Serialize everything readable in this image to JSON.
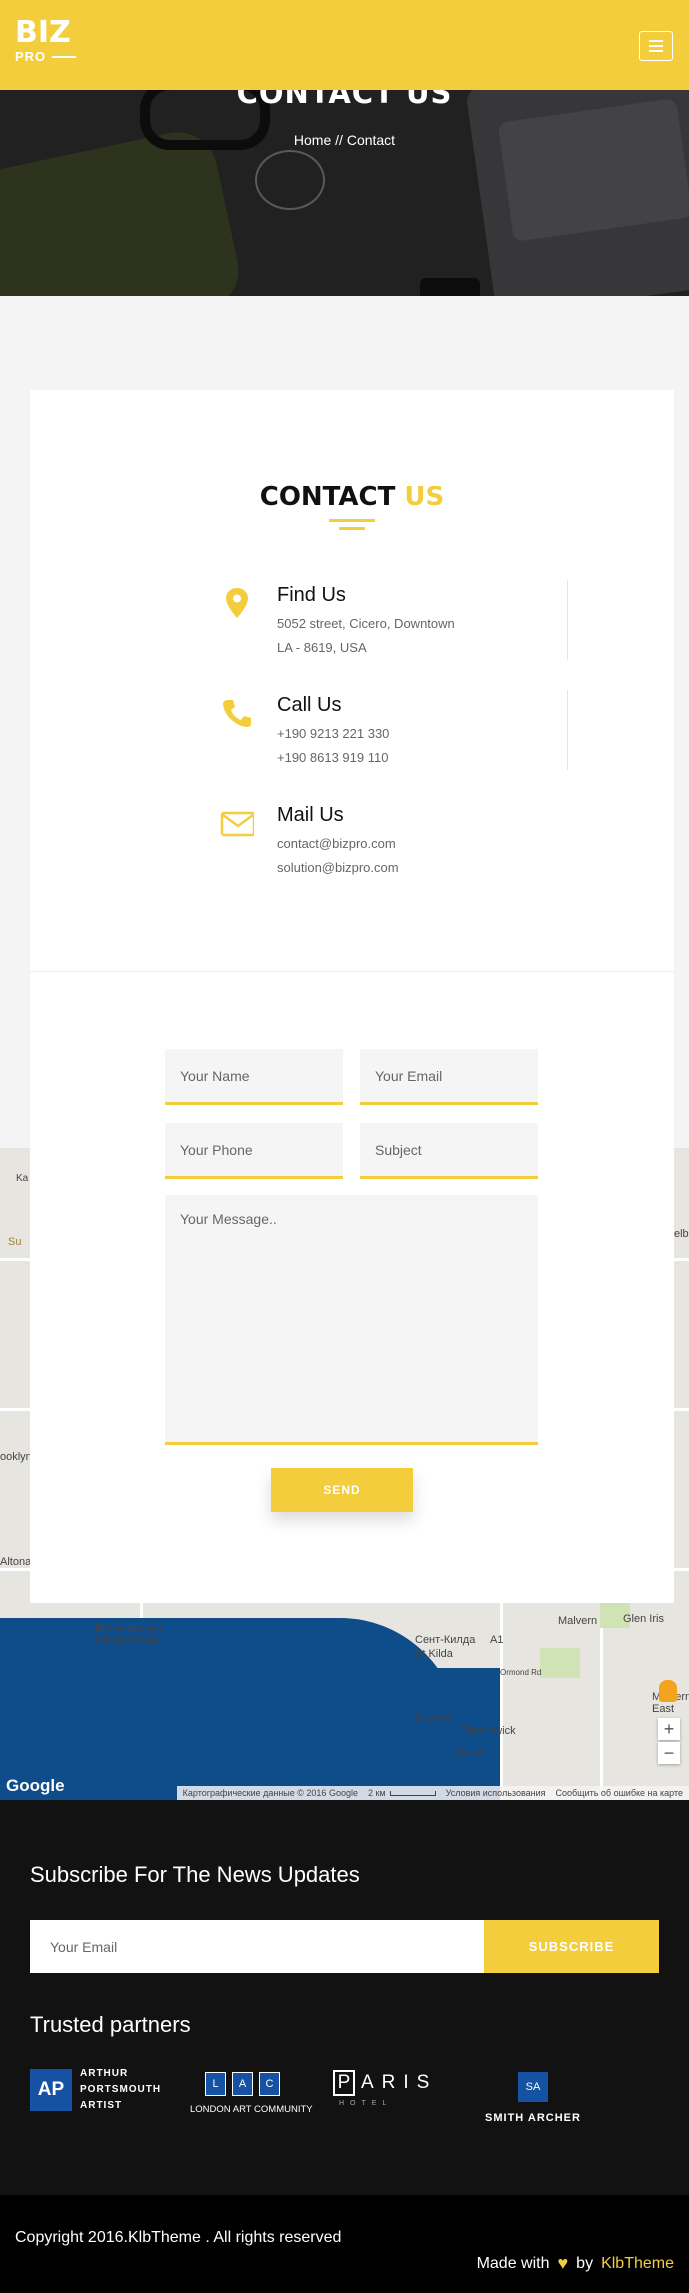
{
  "header": {
    "logo_main": "BIZ",
    "logo_sub": "PRO"
  },
  "hero": {
    "title": "CONTACT US",
    "breadcrumb_home": "Home",
    "breadcrumb_sep": "//",
    "breadcrumb_current": "Contact"
  },
  "contact": {
    "title_main": "CONTACT",
    "title_accent": "US",
    "items": [
      {
        "icon": "map-pin-icon",
        "heading": "Find Us",
        "line1": "5052 street, Cicero, Downtown",
        "line2": "LA - 8619, USA"
      },
      {
        "icon": "phone-icon",
        "heading": "Call Us",
        "line1": "+190 9213 221 330",
        "line2": "+190 8613 919 110"
      },
      {
        "icon": "envelope-icon",
        "heading": "Mail Us",
        "line1": "contact@bizpro.com",
        "line2": "solution@bizpro.com"
      }
    ],
    "accent_color": "#f4cd3d"
  },
  "form": {
    "name_placeholder": "Your Name",
    "email_placeholder": "Your Email",
    "phone_placeholder": "Your Phone",
    "subject_placeholder": "Subject",
    "message_placeholder": "Your Message..",
    "send_label": "SEND"
  },
  "map": {
    "labels": [
      "Вильямстаун",
      "Williamstown",
      "Сент-Килда",
      "St Kilda",
      "Malvern",
      "Glen Iris",
      "Malvern East",
      "Elwood",
      "Elsternwick",
      "Ormond Rd",
      "New St",
      "Su",
      "elb",
      "ooklyn",
      "Altona",
      "Ka",
      "A1"
    ],
    "google": "Google",
    "attribution": "Картографические данные © 2016 Google",
    "scale": "2 км",
    "terms": "Условия использования",
    "report": "Сообщить об ошибке на карте",
    "zoom_in": "+",
    "zoom_out": "−"
  },
  "footer": {
    "subscribe_title": "Subscribe For The News Updates",
    "email_placeholder": "Your Email",
    "subscribe_label": "SUBSCRIBE",
    "partners_title": "Trusted partners",
    "partners": {
      "p1_box": "AP",
      "p1_line1": "ARTHUR",
      "p1_line2": "PORTSMOUTH",
      "p1_line3": "ARTIST",
      "p2_l": "L",
      "p2_a": "A",
      "p2_c": "C",
      "p2_text": "LONDON ART COMMUNITY",
      "p3_p": "P",
      "p3_rest": "ARIS",
      "p3_small": "HOTEL",
      "p4_box": "SA",
      "p4_text": "SMITH ARCHER"
    },
    "copyright": "Copyright 2016.KlbTheme . All rights reserved",
    "made_with": "Made with",
    "by": "by",
    "brand": "KlbTheme"
  }
}
